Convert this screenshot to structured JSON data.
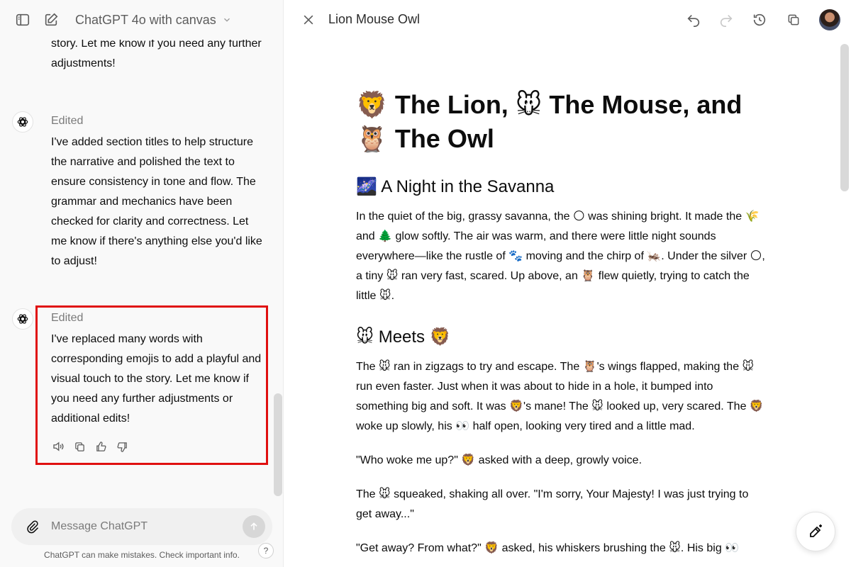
{
  "chat": {
    "model_title": "ChatGPT 4o with canvas",
    "messages": [
      {
        "text": "story. Let me know if you need any further adjustments!"
      },
      {
        "status": "Edited",
        "text": "I've added section titles to help structure the narrative and polished the text to ensure consistency in tone and flow. The grammar and mechanics have been checked for clarity and correctness. Let me know if there's anything else you'd like to adjust!"
      },
      {
        "status": "Edited",
        "text": "I've replaced many words with corresponding emojis to add a playful and visual touch to the story. Let me know if you need any further adjustments or additional edits!"
      }
    ],
    "composer_placeholder": "Message ChatGPT",
    "disclaimer": "ChatGPT can make mistakes. Check important info.",
    "help_label": "?"
  },
  "canvas": {
    "doc_title": "Lion Mouse Owl",
    "heading": "🦁 The Lion, 🐭 The Mouse, and 🦉 The Owl",
    "sections": [
      {
        "title": "🌌 A Night in the Savanna",
        "paragraphs": [
          "In the quiet of the big, grassy savanna, the 🌕 was shining bright. It made the 🌾 and 🌲 glow softly. The air was warm, and there were little night sounds everywhere—like the rustle of 🐾 moving and the chirp of 🦗. Under the silver 🌕, a tiny 🐭 ran very fast, scared. Up above, an 🦉 flew quietly, trying to catch the little 🐭."
        ]
      },
      {
        "title": "🐭 Meets 🦁",
        "paragraphs": [
          "The 🐭 ran in zigzags to try and escape. The 🦉's wings flapped, making the 🐭 run even faster. Just when it was about to hide in a hole, it bumped into something big and soft. It was 🦁's mane! The 🐭 looked up, very scared. The 🦁 woke up slowly, his 👀 half open, looking very tired and a little mad.",
          "\"Who woke me up?\" 🦁 asked with a deep, growly voice.",
          "The 🐭 squeaked, shaking all over. \"I'm sorry, Your Majesty! I was just trying to get away...\"",
          "\"Get away? From what?\" 🦁 asked, his whiskers brushing the 🐭. His big 👀"
        ]
      }
    ]
  }
}
